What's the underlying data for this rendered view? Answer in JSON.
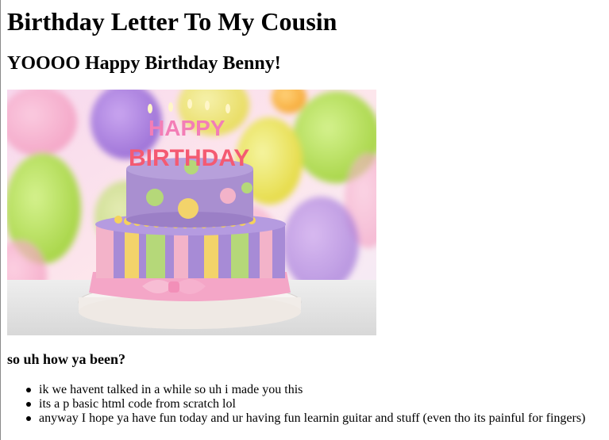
{
  "page": {
    "title": "Birthday Letter To My Cousin",
    "greeting": "YOOOO Happy Birthday Benny!",
    "image": {
      "icon": "birthday-cake-image",
      "candle_letters_top": "HAPPY",
      "candle_letters_bottom": "BIRTHDAY",
      "colors": {
        "tier_top": "#a98fd0",
        "tier_bottom": "#a78bd6",
        "ribbon": "#f4a6c7",
        "stripe_yellow": "#f3d36a",
        "stripe_green": "#b5d879",
        "stripe_pink": "#f3b3c9"
      }
    },
    "question": "so uh how ya been?",
    "list_items": [
      "ik we havent talked in a while so uh i made you this",
      "its a p basic html code from scratch lol",
      "anyway I hope ya have fun today and ur having fun learnin guitar and stuff (even tho its painful for fingers)"
    ]
  }
}
